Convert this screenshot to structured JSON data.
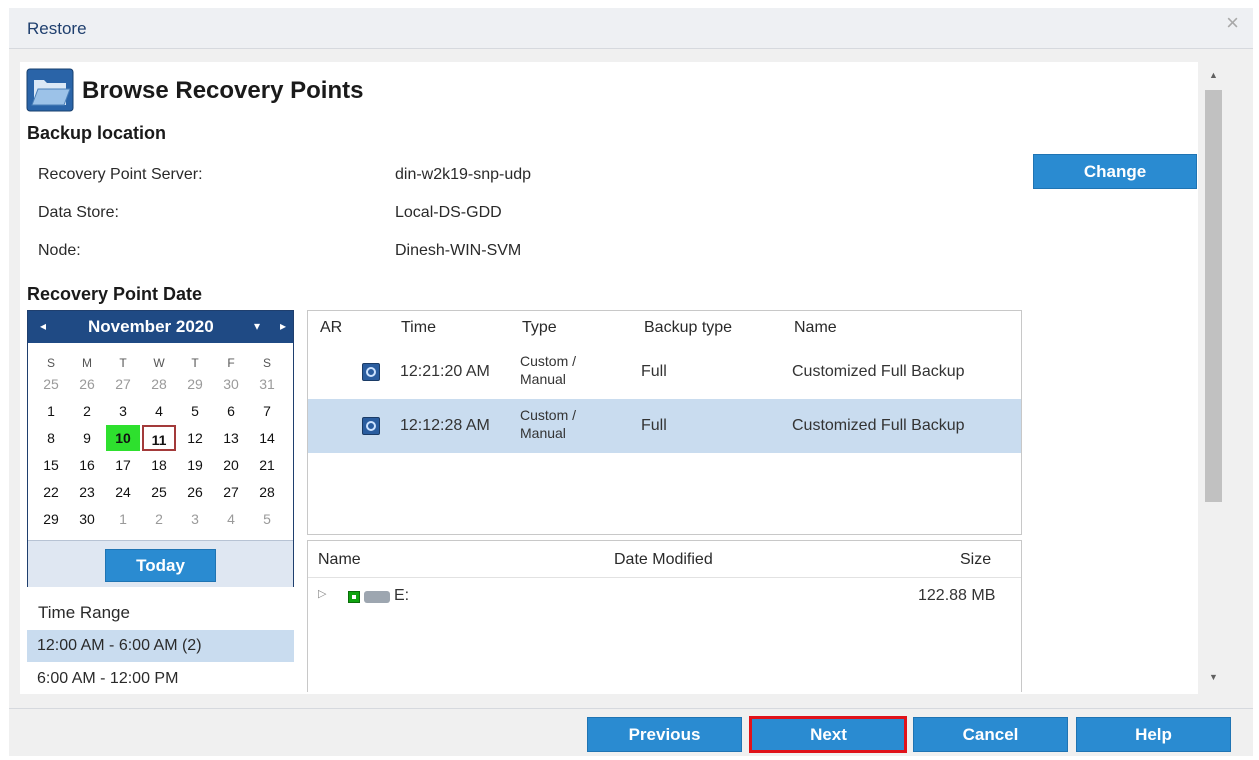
{
  "dialog": {
    "title": "Restore",
    "close_label": "×"
  },
  "page": {
    "heading": "Browse Recovery Points"
  },
  "backup_location": {
    "title": "Backup location",
    "fields": [
      {
        "label": "Recovery Point Server:",
        "value": "din-w2k19-snp-udp"
      },
      {
        "label": "Data Store:",
        "value": "Local-DS-GDD"
      },
      {
        "label": "Node:",
        "value": "Dinesh-WIN-SVM"
      }
    ],
    "change_label": "Change"
  },
  "recovery_point_date": {
    "title": "Recovery Point Date",
    "calendar": {
      "month_label": "November 2020",
      "prev": "◂",
      "dropdown": "▾",
      "next": "▸",
      "dows": [
        "S",
        "M",
        "T",
        "W",
        "T",
        "F",
        "S"
      ],
      "weeks": [
        [
          "25",
          "26",
          "27",
          "28",
          "29",
          "30",
          "31"
        ],
        [
          "1",
          "2",
          "3",
          "4",
          "5",
          "6",
          "7"
        ],
        [
          "8",
          "9",
          "10",
          "11",
          "12",
          "13",
          "14"
        ],
        [
          "15",
          "16",
          "17",
          "18",
          "19",
          "20",
          "21"
        ],
        [
          "22",
          "23",
          "24",
          "25",
          "26",
          "27",
          "28"
        ],
        [
          "29",
          "30",
          "1",
          "2",
          "3",
          "4",
          "5"
        ]
      ],
      "selected_day": "10",
      "today_day": "11",
      "today_label": "Today"
    }
  },
  "time_range": {
    "title": "Time Range",
    "items": [
      {
        "label": "12:00 AM - 6:00 AM   (2)",
        "active": true
      },
      {
        "label": "6:00 AM - 12:00 PM",
        "active": false
      }
    ]
  },
  "recovery_points": {
    "headers": {
      "ar": "AR",
      "time": "Time",
      "type": "Type",
      "backup_type": "Backup type",
      "name": "Name"
    },
    "rows": [
      {
        "time": "12:21:20 AM",
        "type": "Custom / Manual",
        "backup_type": "Full",
        "name": "Customized Full Backup",
        "selected": false
      },
      {
        "time": "12:12:28 AM",
        "type": "Custom / Manual",
        "backup_type": "Full",
        "name": "Customized Full Backup",
        "selected": true
      }
    ]
  },
  "files": {
    "headers": {
      "name": "Name",
      "date_modified": "Date Modified",
      "size": "Size"
    },
    "rows": [
      {
        "expander": "▷",
        "name": "E:",
        "size": "122.88 MB"
      }
    ]
  },
  "footer": {
    "previous_label": "Previous",
    "next_label": "Next",
    "cancel_label": "Cancel",
    "help_label": "Help"
  },
  "colors": {
    "accent": "#2a8bd1",
    "header": "#1f4a84",
    "selection": "#c9dcef",
    "highlight": "#e0121a"
  }
}
